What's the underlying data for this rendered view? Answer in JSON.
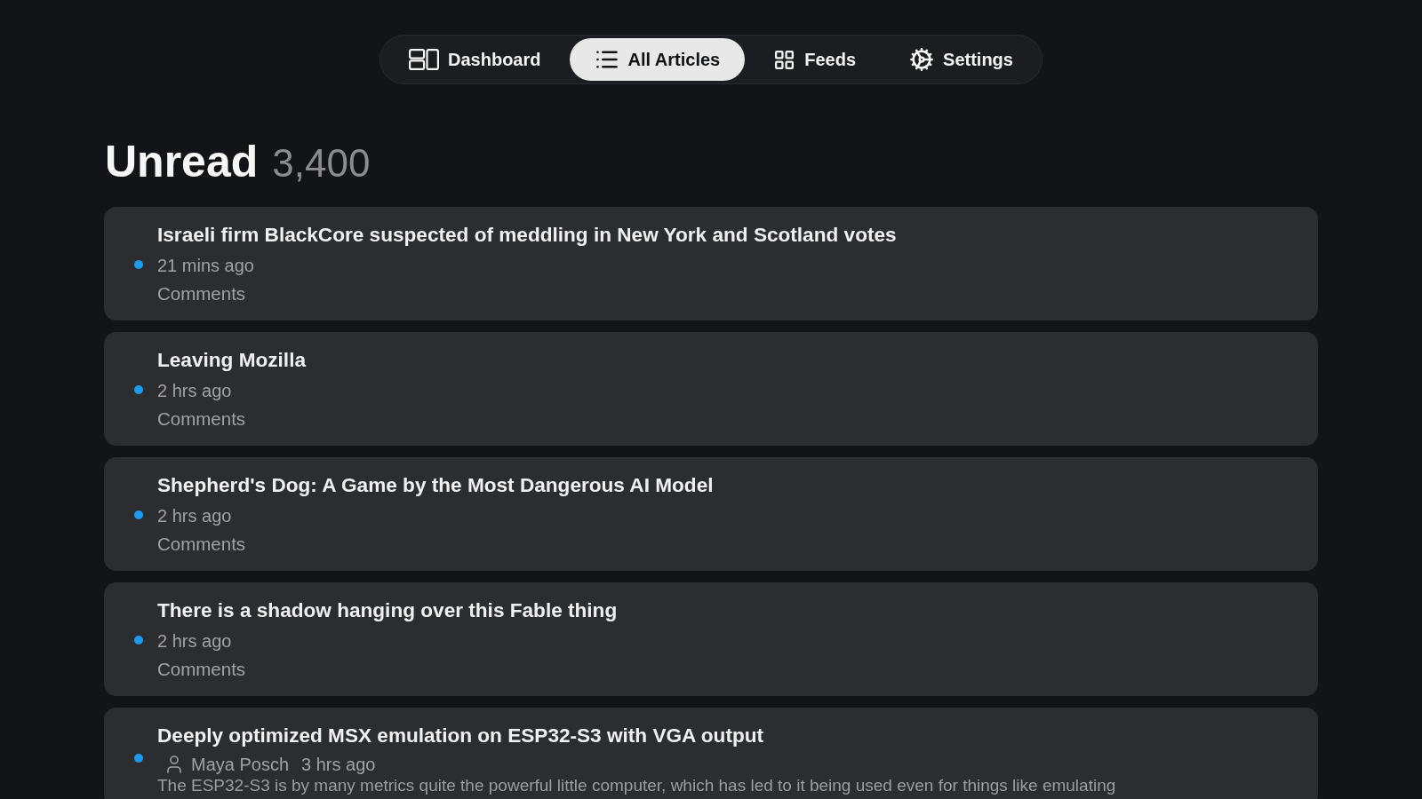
{
  "nav": {
    "tabs": [
      {
        "label": "Dashboard",
        "selected": false
      },
      {
        "label": "All Articles",
        "selected": true
      },
      {
        "label": "Feeds",
        "selected": false
      },
      {
        "label": "Settings",
        "selected": false
      }
    ]
  },
  "header": {
    "title": "Unread",
    "count": "3,400"
  },
  "articles": [
    {
      "title": "Israeli firm BlackCore suspected of meddling in New York and Scotland votes",
      "unread": true,
      "time": "21 mins ago",
      "link": "Comments"
    },
    {
      "title": "Leaving Mozilla",
      "unread": true,
      "time": "2 hrs ago",
      "link": "Comments"
    },
    {
      "title": "Shepherd's Dog: A Game by the Most Dangerous AI Model",
      "unread": true,
      "time": "2 hrs ago",
      "link": "Comments"
    },
    {
      "title": "There is a shadow hanging over this Fable thing",
      "unread": true,
      "time": "2 hrs ago",
      "link": "Comments"
    },
    {
      "title": "Deeply optimized MSX emulation on ESP32-S3 with VGA output",
      "unread": true,
      "author": "Maya Posch",
      "time": "3 hrs ago",
      "excerpt": "The ESP32-S3 is by many metrics quite the powerful little computer, which has led to it being used even for things like emulating"
    }
  ]
}
